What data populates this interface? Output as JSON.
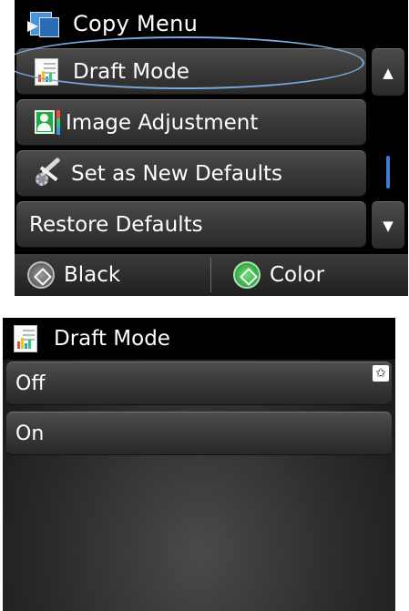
{
  "copy_menu": {
    "title": "Copy Menu",
    "items": [
      {
        "label": "Draft Mode",
        "icon": "draft-icon"
      },
      {
        "label": "Image Adjustment",
        "icon": "image-adjust-icon"
      },
      {
        "label": "Set as New Defaults",
        "icon": "tools-icon"
      },
      {
        "label": "Restore Defaults",
        "icon": ""
      }
    ],
    "scroll": {
      "up_glyph": "▲",
      "down_glyph": "▼"
    },
    "start_black_label": "Black",
    "start_color_label": "Color"
  },
  "draft_mode": {
    "title": "Draft Mode",
    "options": [
      {
        "label": "Off",
        "default_star": "✩"
      },
      {
        "label": "On"
      }
    ]
  },
  "colors": {
    "highlight_oval": "#7aa9dc",
    "scroll_thumb": "#3c7bd6",
    "start_black": "#4a4a4a",
    "start_color": "#1e8f2e"
  }
}
